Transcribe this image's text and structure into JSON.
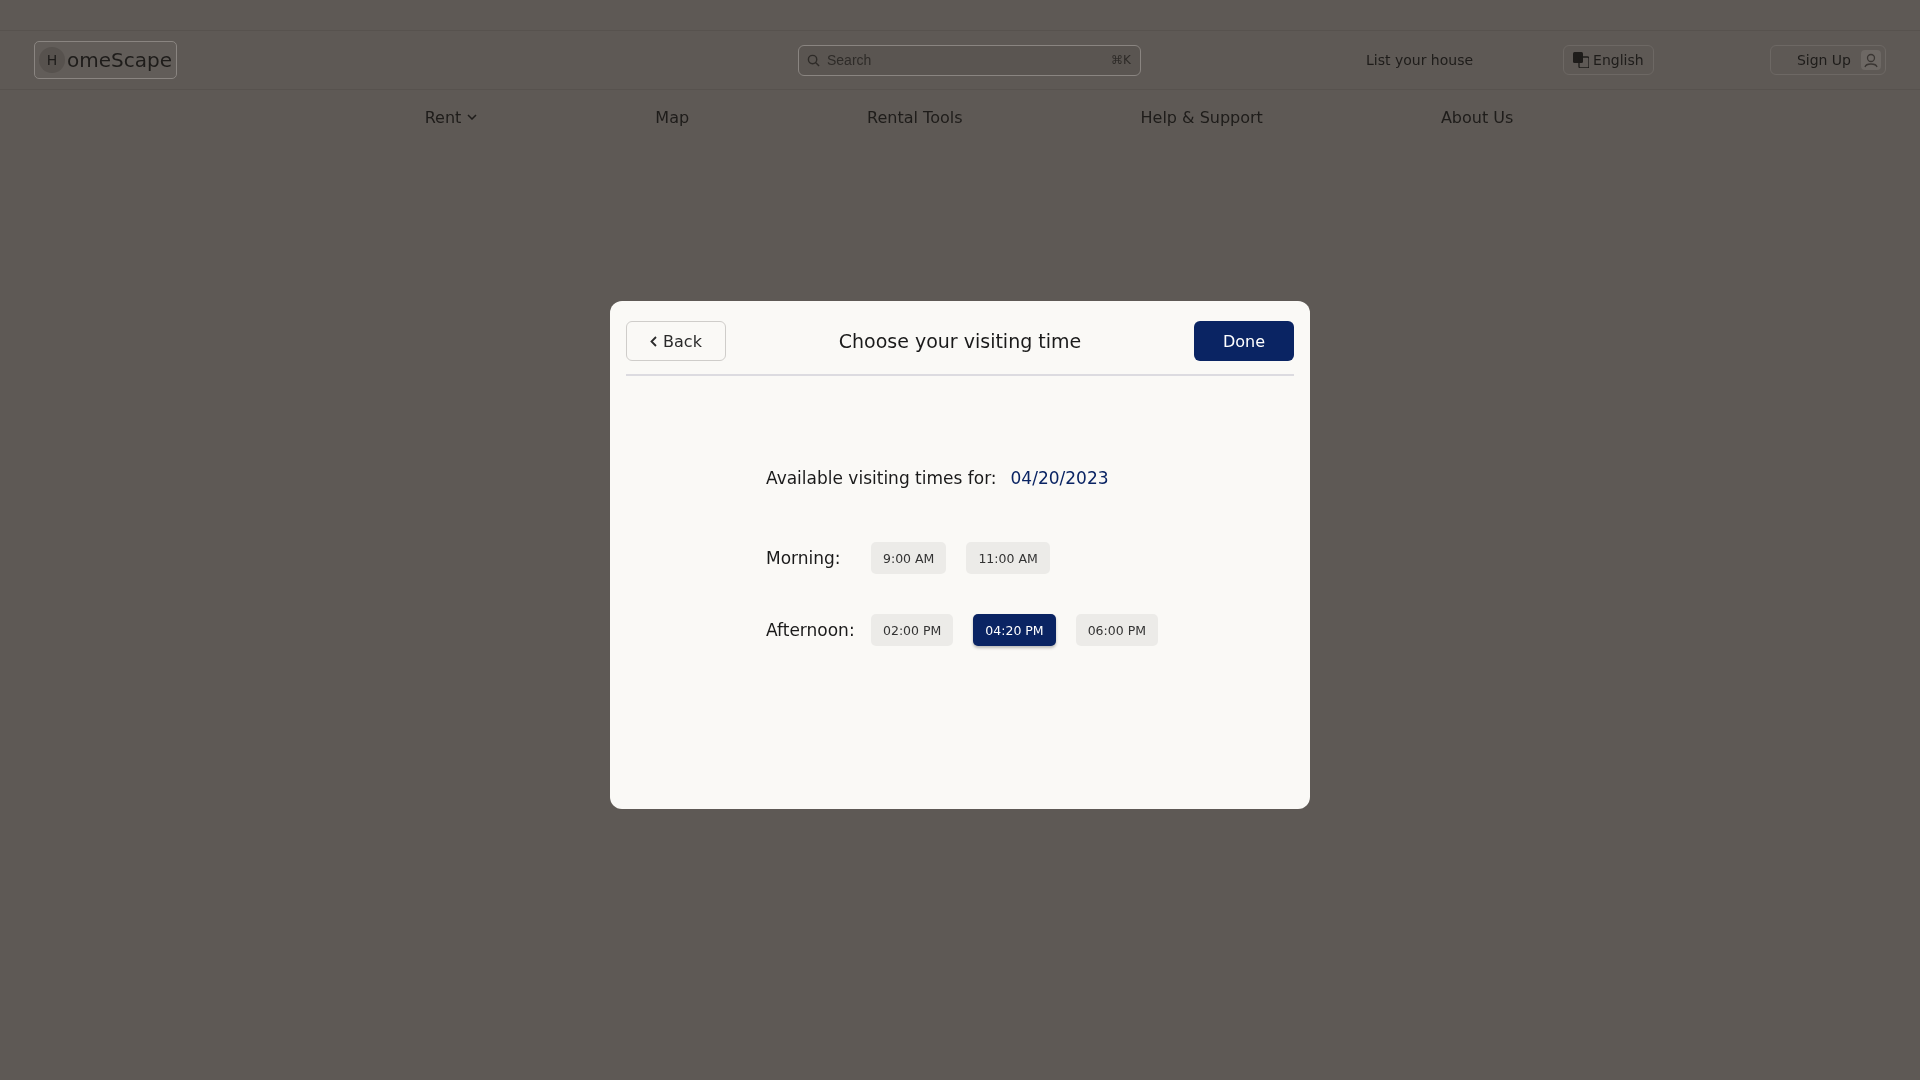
{
  "header": {
    "logo": {
      "letter": "H",
      "name": "omeScape"
    },
    "search": {
      "placeholder": "Search",
      "shortcut": "⌘K"
    },
    "list_link": "List your house",
    "language": "English",
    "sign_up": "Sign Up"
  },
  "nav": [
    {
      "label": "Rent",
      "has_menu": true
    },
    {
      "label": "Map",
      "has_menu": false
    },
    {
      "label": "Rental Tools",
      "has_menu": false
    },
    {
      "label": "Help & Support",
      "has_menu": false
    },
    {
      "label": "About Us",
      "has_menu": false
    }
  ],
  "dialog": {
    "back": "Back",
    "title": "Choose your visiting time",
    "done": "Done",
    "available_label": "Available visiting times for:",
    "date": "04/20/2023",
    "groups": [
      {
        "label": "Morning:",
        "slots": [
          {
            "time": "9:00 AM",
            "selected": false
          },
          {
            "time": "11:00 AM",
            "selected": false
          }
        ]
      },
      {
        "label": "Afternoon:",
        "slots": [
          {
            "time": "02:00 PM",
            "selected": false
          },
          {
            "time": "04:20 PM",
            "selected": true
          },
          {
            "time": "06:00 PM",
            "selected": false
          }
        ]
      }
    ]
  }
}
